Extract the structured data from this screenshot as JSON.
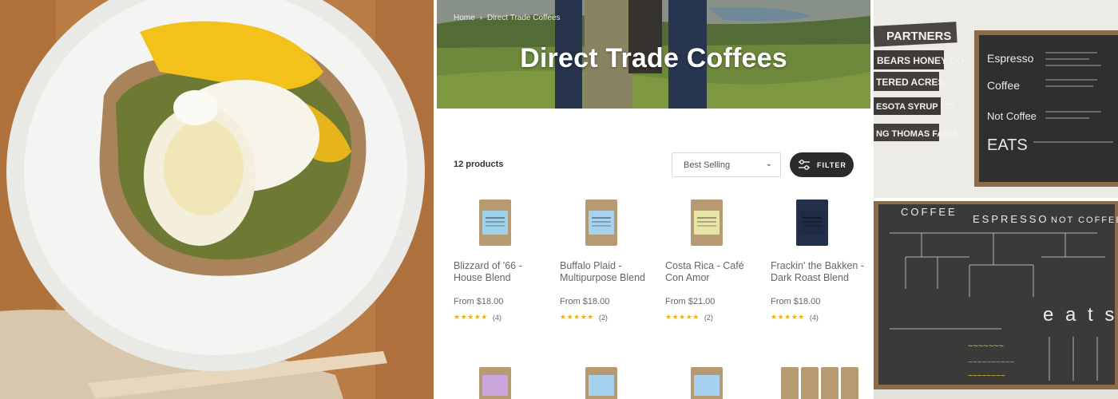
{
  "store": {
    "breadcrumb": {
      "home": "Home",
      "separator": "›",
      "current": "Direct Trade Coffees"
    },
    "title": "Direct Trade Coffees",
    "product_count": "12 products",
    "sort": {
      "selected": "Best Selling"
    },
    "filter_label": "FILTER",
    "products": [
      {
        "name": "Blizzard of '66 - House Blend",
        "price": "From $18.00",
        "stars": "★★★★★",
        "reviews": "(4)",
        "label_color": "#9fd0ea"
      },
      {
        "name": "Buffalo Plaid - Multipurpose Blend",
        "price": "From $18.00",
        "stars": "★★★★★",
        "reviews": "(2)",
        "label_color": "#a7d3ef"
      },
      {
        "name": "Costa Rica - Café Con Amor",
        "price": "From $21.00",
        "stars": "★★★★★",
        "reviews": "(2)",
        "label_color": "#e8e3a6"
      },
      {
        "name": "Frackin' the Bakken - Dark Roast Blend",
        "price": "From $18.00",
        "stars": "★★★★★",
        "reviews": "(4)",
        "label_color": "#1f2a44"
      }
    ],
    "next_row_label_colors": [
      "#c9a6dc",
      "#a6d2ef",
      "#a6d2ef",
      "#c9a6dc"
    ]
  },
  "photos": {
    "right_top_signs": [
      "PARTNERS",
      "BEARS HONEY CO",
      "TERED ACRES",
      "ESOTA SYRUP CO.",
      "NG THOMAS FARM"
    ],
    "right_top_menu": [
      "Espresso",
      "Coffee",
      "Not Coffee",
      "EATS"
    ],
    "right_bottom_menu": [
      "COFFEE",
      "ESPRESSO",
      "NOT COFFEE",
      "e a t s !"
    ]
  },
  "colors": {
    "accent": "#2b2b2b",
    "star": "#e9b21a"
  }
}
